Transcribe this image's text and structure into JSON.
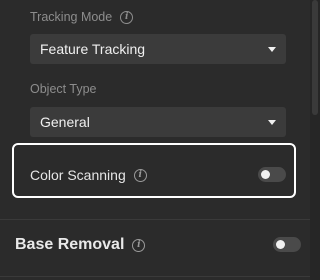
{
  "tracking": {
    "label": "Tracking Mode",
    "info_icon": "info-icon",
    "selected": "Feature Tracking"
  },
  "object_type": {
    "label": "Object Type",
    "selected": "General"
  },
  "color_scanning": {
    "label": "Color Scanning",
    "info_icon": "info-icon",
    "enabled": false
  },
  "base_removal": {
    "label": "Base Removal",
    "info_icon": "info-icon",
    "enabled": false
  },
  "colors": {
    "background": "#2b2b2b",
    "select_bg": "#3b3b3b",
    "highlight_border": "#ffffff",
    "toggle_off": "#4a4a4a"
  }
}
